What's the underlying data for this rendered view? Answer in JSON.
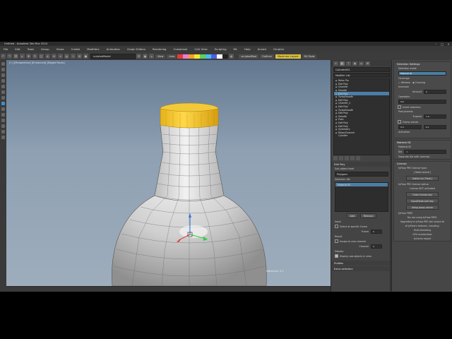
{
  "window": {
    "title": "Untitled - Autodesk 3ds Max 2024",
    "controls": [
      "–",
      "□",
      "×"
    ]
  },
  "menu": [
    "File",
    "Edit",
    "Tools",
    "Group",
    "Views",
    "Create",
    "Modifiers",
    "Animation",
    "Graph Editors",
    "Rendering",
    "Customize",
    "Civil View",
    "Scripting",
    "ML",
    "Help",
    "Arnold",
    "Ornatrix"
  ],
  "toolbar": {
    "selection_set": "scriptedModel",
    "btn1": "View",
    "btn2": "Auto",
    "swatch_colors": [
      "#e83a3a",
      "#ef7bd0",
      "#f3a02a",
      "#f6e63a",
      "#5ad25a",
      "#4ab9ef",
      "#4a5def",
      "#ffffff",
      "#222222"
    ],
    "right_btns": [
      "scriptedMod",
      "Outliner",
      "Maximize Layout",
      "ML Tools"
    ]
  },
  "viewport": {
    "label": "[+] [Perspective] [Enhanced] [Edged Faces]",
    "status": "Materials: 0 0"
  },
  "command_panel": {
    "object_name": "Cylinder001",
    "modifier_list": "Modifier List",
    "stack": [
      "Relax Pro",
      "Edit Poly",
      "Chamfer",
      "Smooth",
      "Edit Poly",
      "TurboSmooth",
      "Edit Poly",
      "Chamfer_2",
      "Edit Poly",
      "TurboSmooth",
      "Edit Poly",
      "Smooth",
      "Push",
      "Edit Poly",
      "Edit Poly",
      "Symmetry",
      "Relax/Channel",
      "Cylinder"
    ],
    "selected_index": 4,
    "rollout_title": "Edit Poly",
    "sub_object_level": "Sub-object level",
    "sub_object_value": "Polygons",
    "selection_list": "Selection list",
    "selection_item": "Material ID",
    "add": "Add",
    "remove": "Remove",
    "input": "Input",
    "select_by_specific_frame": "Select at specific frame",
    "frame_label": "Frame",
    "frame_value": "0",
    "result": "Result",
    "assign_to": "Assign to new channel",
    "channel_label": "Channel",
    "channel_value": "0",
    "display": "Display",
    "display_sub": "Display sub-objects in view",
    "profiles": "Profiles",
    "extra_selection": "Extra selection"
  },
  "right_panel": {
    "selection_settings": "Selection Settings",
    "selection_mode": "Selection mode",
    "mode_value": "Material ID",
    "coverage": "Coverage",
    "window": "Window",
    "crossing": "Crossing",
    "invert": "Inversion",
    "amount_label": "Amount",
    "amount_value": "0",
    "operation": "Operation",
    "operation_value": "Set",
    "invert_selection": "Invert selection",
    "post_process": "Post-process",
    "expand": "Expand",
    "expand_value": "1.0",
    "clamp": "Clamp values",
    "clamp_min": "0.0",
    "clamp_max": "1.0",
    "activation": "Activation",
    "material_id_title": "Material ID",
    "material_id_label": "Material ID",
    "ids_label": "IDs",
    "ids_value": "1",
    "separate": "Separate IDs with commas",
    "license_title": "License",
    "license_type": "tyFlow PRO license type:",
    "node_locked": "[ Node-locked ]",
    "switch_float": "Switch to [ Float ]",
    "license_status": "tyFlow PRO license status:",
    "not_activated": "License NOT activated",
    "order_license": "Order license key",
    "input_license": "Input/Node-lock key",
    "setup_proxy": "Setup proxy server",
    "tyflow_free": "tyFlow FREE",
    "using_free": "You are using tyFlow FREE.",
    "upgrade_1": "Upgrading to tyFlow PRO will unlock all",
    "upgrade_2": "of tyFlow's features, including:",
    "feature_1": "Multi-threading",
    "feature_2": "GPU acceleration",
    "feature_3": "tyCache export"
  }
}
